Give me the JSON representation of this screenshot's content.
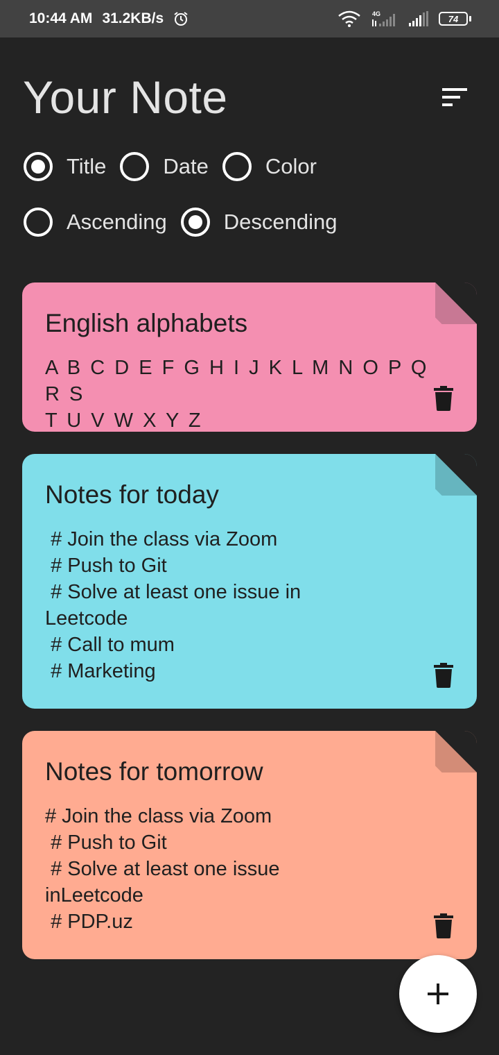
{
  "status_bar": {
    "time": "10:44 AM",
    "speed": "31.2KB/s",
    "network": "4G",
    "battery": "74"
  },
  "header": {
    "title": "Your Note"
  },
  "sort_by": {
    "options": [
      "Title",
      "Date",
      "Color"
    ],
    "selected": "Title"
  },
  "order": {
    "options": [
      "Ascending",
      "Descending"
    ],
    "selected": "Descending"
  },
  "notes": [
    {
      "title": "English alphabets",
      "content": "A B C D E F G H I J K L M N O P Q R S\nT U V W X Y Z",
      "color": "#f48fb1",
      "fold_color": "#c87894"
    },
    {
      "title": "Notes for today",
      "content": " # Join the class via Zoom\n # Push to Git\n # Solve at least one issue in\nLeetcode\n # Call to mum\n # Marketing",
      "color": "#80deea",
      "fold_color": "#66b5bf"
    },
    {
      "title": "Notes for tomorrow",
      "content": "# Join the class via Zoom\n # Push to Git\n # Solve at least one issue\ninLeetcode\n # PDP.uz",
      "color": "#ffab91",
      "fold_color": "#d38c77"
    }
  ],
  "colors": {
    "background": "#232323",
    "status_bar": "#424242",
    "text": "#e4e4e4"
  }
}
